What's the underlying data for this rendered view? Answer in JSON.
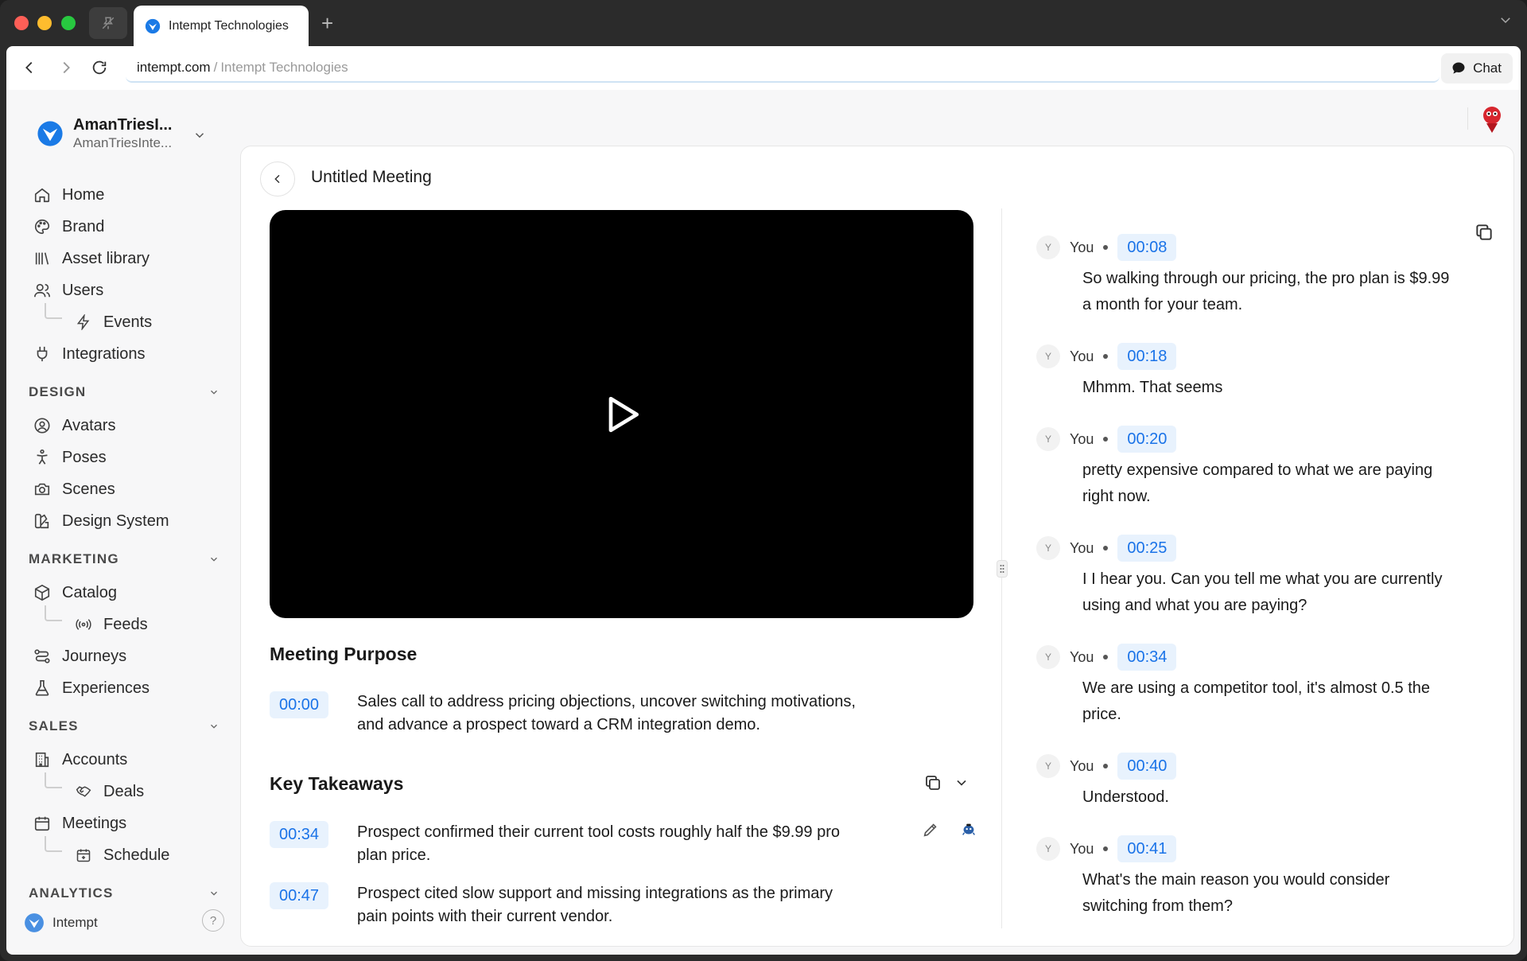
{
  "browser": {
    "tab_title": "Intempt Technologies",
    "url_host": "intempt.com",
    "url_separator": "/",
    "url_title": "Intempt Technologies",
    "chat_label": "Chat"
  },
  "workspace": {
    "name": "AmanTriesI...",
    "subtitle": "AmanTriesInte..."
  },
  "sidebar": {
    "items": [
      {
        "label": "Home"
      },
      {
        "label": "Brand"
      },
      {
        "label": "Asset library"
      },
      {
        "label": "Users"
      },
      {
        "label": "Events"
      },
      {
        "label": "Integrations"
      }
    ],
    "design": {
      "title": "DESIGN",
      "items": [
        {
          "label": "Avatars"
        },
        {
          "label": "Poses"
        },
        {
          "label": "Scenes"
        },
        {
          "label": "Design System"
        }
      ]
    },
    "marketing": {
      "title": "MARKETING",
      "items": [
        {
          "label": "Catalog"
        },
        {
          "label": "Feeds"
        },
        {
          "label": "Journeys"
        },
        {
          "label": "Experiences"
        }
      ]
    },
    "sales": {
      "title": "SALES",
      "items": [
        {
          "label": "Accounts"
        },
        {
          "label": "Deals"
        },
        {
          "label": "Meetings"
        },
        {
          "label": "Schedule"
        }
      ]
    },
    "analytics": {
      "title": "ANALYTICS"
    },
    "footer": {
      "brand": "Intempt",
      "help": "?"
    }
  },
  "meeting": {
    "title": "Untitled Meeting",
    "purpose": {
      "heading": "Meeting Purpose",
      "timestamp": "00:00",
      "text_line1": "Sales call to address pricing objections, uncover switching motivations,",
      "text_line2": "and advance a prospect toward a CRM integration demo."
    },
    "takeaways": {
      "heading": "Key Takeaways",
      "items": [
        {
          "timestamp": "00:34",
          "line1": "Prospect confirmed their current tool costs roughly half the $9.99 pro",
          "line2": "plan price."
        },
        {
          "timestamp": "00:47",
          "line1": "Prospect cited slow support and missing integrations as the primary",
          "line2": "pain points with their current vendor."
        }
      ]
    }
  },
  "transcript": [
    {
      "avatar": "Y",
      "speaker": "You",
      "timestamp": "00:08",
      "line1": "So walking through our pricing, the pro plan is $9.99",
      "line2": "a month for your team."
    },
    {
      "avatar": "Y",
      "speaker": "You",
      "timestamp": "00:18",
      "line1": "Mhmm. That seems",
      "line2": ""
    },
    {
      "avatar": "Y",
      "speaker": "You",
      "timestamp": "00:20",
      "line1": "pretty expensive compared to what we are paying",
      "line2": "right now."
    },
    {
      "avatar": "Y",
      "speaker": "You",
      "timestamp": "00:25",
      "line1": "I I hear you. Can you tell me what you are currently",
      "line2": "using and what you are paying?"
    },
    {
      "avatar": "Y",
      "speaker": "You",
      "timestamp": "00:34",
      "line1": "We are using a competitor tool, it's almost 0.5 the",
      "line2": "price."
    },
    {
      "avatar": "Y",
      "speaker": "You",
      "timestamp": "00:40",
      "line1": "Understood.",
      "line2": ""
    },
    {
      "avatar": "Y",
      "speaker": "You",
      "timestamp": "00:41",
      "line1": "What's the main reason you would consider",
      "line2": "switching from them?"
    }
  ]
}
